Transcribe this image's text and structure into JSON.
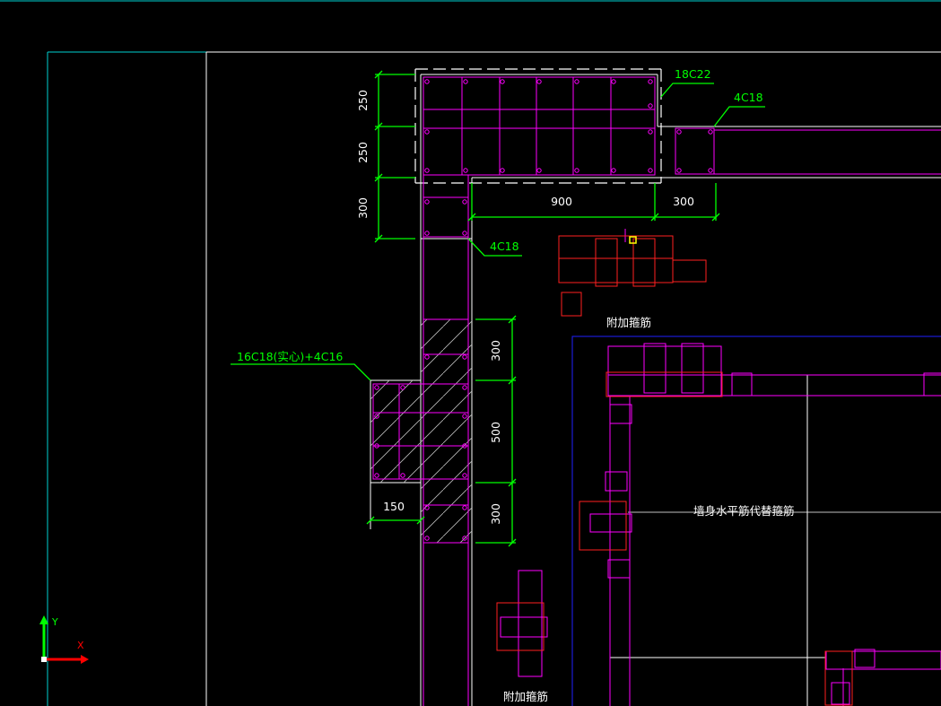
{
  "drawing": {
    "background": "#000000",
    "colors": {
      "frame": "#00d0d0",
      "wall_outline": "#ffffff",
      "rebar": "#ff00ff",
      "stirrup": "#ff2020",
      "dimension": "#00ff00",
      "hatch": "#bbbbbb",
      "region": "#2020ff",
      "cursor": "#ffff00"
    },
    "dimensions": {
      "top_left_250a": "250",
      "top_left_250b": "250",
      "top_left_300": "300",
      "horizontal_900": "900",
      "horizontal_300": "300",
      "side_300_upper": "300",
      "side_500": "500",
      "side_300_lower": "300",
      "width_150": "150"
    },
    "callouts": {
      "corner_bars": "18C22",
      "right_wall_bars": "4C18",
      "lower_wall_bars": "4C18",
      "column_bars": "16C18(实心)+4C16"
    },
    "notes": {
      "extra_stirrup_top": "附加箍筋",
      "extra_stirrup_bottom": "附加箍筋",
      "wall_horizontal_note": "墙身水平筋代替箍筋"
    },
    "ucs": {
      "y_label": "Y",
      "x_label": "X"
    }
  }
}
